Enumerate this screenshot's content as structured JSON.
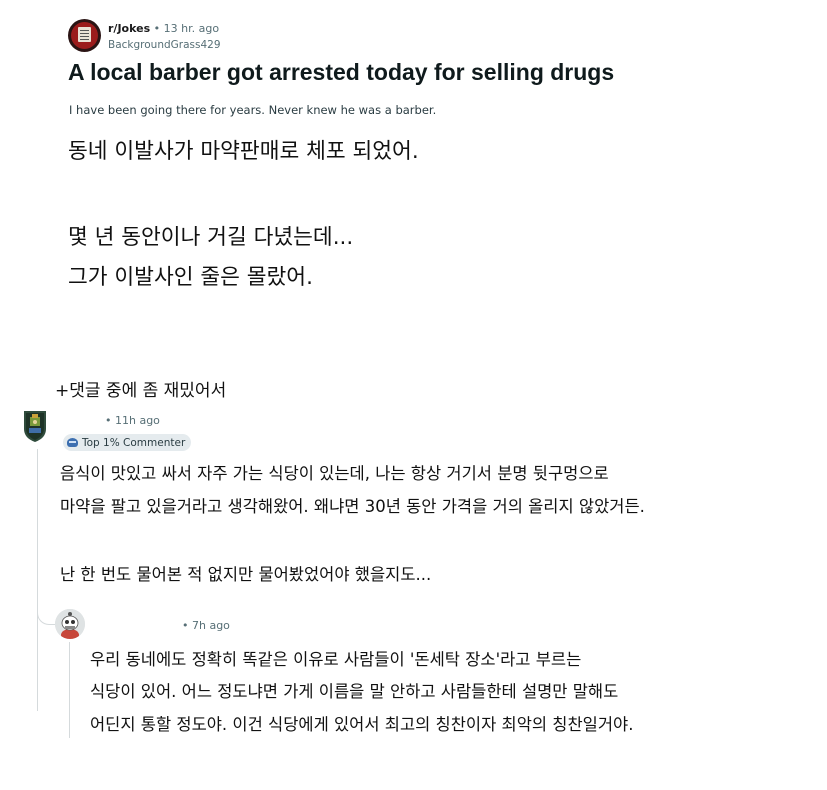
{
  "post": {
    "subreddit": "r/Jokes",
    "dot": "•",
    "time": "13 hr. ago",
    "author": "BackgroundGrass429",
    "title": "A local barber got arrested today for selling drugs",
    "body": "I have been going there for years. Never knew he was a barber.",
    "translation": [
      "동네 이발사가 마약판매로 체포 되었어.",
      "몇 년 동안이나 거길 다녔는데...",
      "그가 이발사인 줄은 몰랐어."
    ]
  },
  "note": "+댓글 중에 좀 재밌어서",
  "comments": [
    {
      "meta": "• 11h ago",
      "flair": "Top 1% Commenter",
      "flair_icon": "helmet-icon",
      "lines": [
        "음식이 맛있고 싸서 자주 가는 식당이 있는데, 나는 항상 거기서 분명 뒷구멍으로",
        "마약을 팔고 있을거라고 생각해왔어. 왜냐면 30년 동안 가격을 거의 올리지 않았거든.",
        "난 한 번도 물어본 적 없지만 물어봤었어야 했을지도..."
      ]
    },
    {
      "meta": "• 7h ago",
      "lines": [
        "우리 동네에도 정확히 똑같은 이유로 사람들이 '돈세탁 장소'라고 부르는",
        "식당이 있어. 어느 정도냐면 가게 이름을 말 안하고 사람들한테 설명만 말해도",
        "어딘지 통할 정도야. 이건 식당에게 있어서 최고의 칭찬이자 최악의 칭찬일거야."
      ]
    }
  ],
  "colors": {
    "text": "#111111",
    "meta": "#576f76",
    "flair_bg": "#e5ebee",
    "thread_line": "#d5dadc",
    "subreddit_icon": "#9b1c1c"
  }
}
